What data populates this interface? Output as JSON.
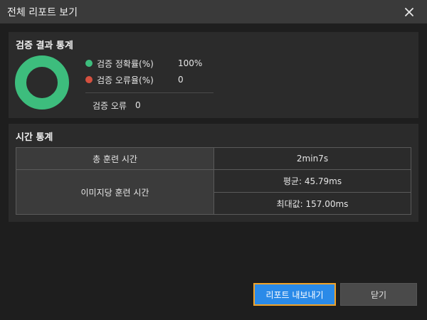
{
  "window": {
    "title": "전체 리포트 보기"
  },
  "validation": {
    "title": "검증 결과 통계",
    "legend": [
      {
        "label": "검증 정확률(%)",
        "value": "100%",
        "color": "#3dbd7d"
      },
      {
        "label": "검증 오류율(%)",
        "value": "0",
        "color": "#d5503f"
      }
    ],
    "error_label": "검증 오류",
    "error_value": "0"
  },
  "chart_data": {
    "type": "pie",
    "categories": [
      "검증 정확률(%)",
      "검증 오류율(%)"
    ],
    "values": [
      100,
      0
    ],
    "colors": [
      "#3dbd7d",
      "#d5503f"
    ],
    "donut": true
  },
  "time_stats": {
    "title": "시간 통계",
    "total_label": "총 훈련 시간",
    "total_value": "2min7s",
    "per_image_label": "이미지당 훈련 시간",
    "avg_value": "평균: 45.79ms",
    "max_value": "최대값: 157.00ms"
  },
  "buttons": {
    "export_label": "리포트 내보내기",
    "close_label": "닫기"
  },
  "colors": {
    "accent": "#2a8ae8",
    "focus_ring": "#f0a32a",
    "success": "#3dbd7d",
    "error": "#d5503f"
  }
}
